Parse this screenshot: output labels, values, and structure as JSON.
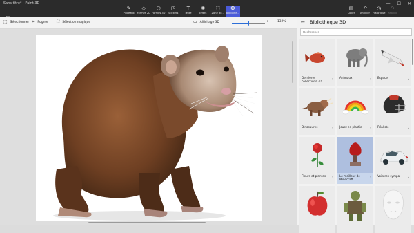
{
  "window": {
    "title": "Sans titre* - Paint 3D",
    "controls": [
      "—",
      "☐",
      "✕"
    ]
  },
  "menu": {
    "label": "Menu"
  },
  "ribbon": {
    "tools": [
      {
        "label": "Pinceaux",
        "icon": "brush-icon"
      },
      {
        "label": "Formes 2D",
        "icon": "shapes-2d-icon"
      },
      {
        "label": "Formes 3D",
        "icon": "shapes-3d-icon"
      },
      {
        "label": "Stickers",
        "icon": "sticker-icon"
      },
      {
        "label": "Texte",
        "icon": "text-icon"
      },
      {
        "label": "Effets",
        "icon": "effects-icon"
      },
      {
        "label": "Zone de...",
        "icon": "canvas-icon"
      },
      {
        "label": "Bibliothè...",
        "icon": "library-icon",
        "active": true
      }
    ],
    "right": [
      {
        "label": "Coller",
        "icon": "paste-icon"
      },
      {
        "label": "Annuler",
        "icon": "undo-icon"
      },
      {
        "label": "Historique",
        "icon": "history-icon"
      },
      {
        "label": "Rétablir",
        "icon": "redo-icon",
        "disabled": true
      }
    ]
  },
  "subbar": {
    "select_label": "Sélectionner",
    "crop_label": "Rogner",
    "magic_select_label": "Sélection magique",
    "view3d_label": "Affichage 3D",
    "zoom_minus": "−",
    "zoom_plus": "+",
    "zoom_level": "132%",
    "zoom_fraction": 0.5,
    "more": "···"
  },
  "library": {
    "title": "Bibliothèque 3D",
    "search_placeholder": "Rechercher",
    "tiles": [
      {
        "label": "Dernières collections 3D",
        "thumb": "fish"
      },
      {
        "label": "Animaux",
        "thumb": "elephant"
      },
      {
        "label": "Espace",
        "thumb": "shuttle"
      },
      {
        "label": "Dinosaures",
        "thumb": "triceratops"
      },
      {
        "label": "Jouet en plastic",
        "thumb": "rainbow"
      },
      {
        "label": "Réaliste",
        "thumb": "helmet"
      },
      {
        "label": "Fleurs et plantes",
        "thumb": "rose"
      },
      {
        "label": "Le meilleur de Minecraft",
        "thumb": "minecraft",
        "highlight": true
      },
      {
        "label": "Voitures sympa",
        "thumb": "car"
      },
      {
        "label": "",
        "thumb": "apple"
      },
      {
        "label": "",
        "thumb": "troll"
      },
      {
        "label": "",
        "thumb": "head"
      }
    ]
  }
}
